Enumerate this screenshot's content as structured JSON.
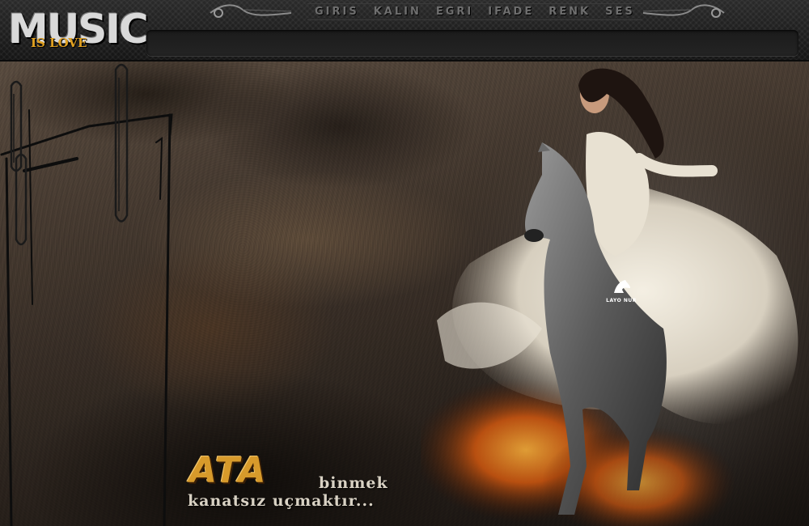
{
  "logo": {
    "main": "MUSIC",
    "sub": "IS LOVE"
  },
  "menu": {
    "items": [
      {
        "label": "GIRIS"
      },
      {
        "label": "KALIN"
      },
      {
        "label": "EGRI"
      },
      {
        "label": "IFADE"
      },
      {
        "label": "RENK"
      },
      {
        "label": "SES"
      }
    ]
  },
  "watermark": {
    "text": "LAYO NUR"
  },
  "slogan": {
    "highlight": "ATA",
    "line1_rest": "binmek",
    "line2": "kanatsız uçmaktır..."
  },
  "colors": {
    "slogan_accent": "#d79a2b",
    "logo_accent": "#e0a020",
    "menu_text": "#6e6e6e"
  },
  "icons": {
    "menu_left": "ornament-scroll-icon",
    "menu_right": "ornament-scroll-icon",
    "watermark": "horse-head-logo-icon"
  }
}
